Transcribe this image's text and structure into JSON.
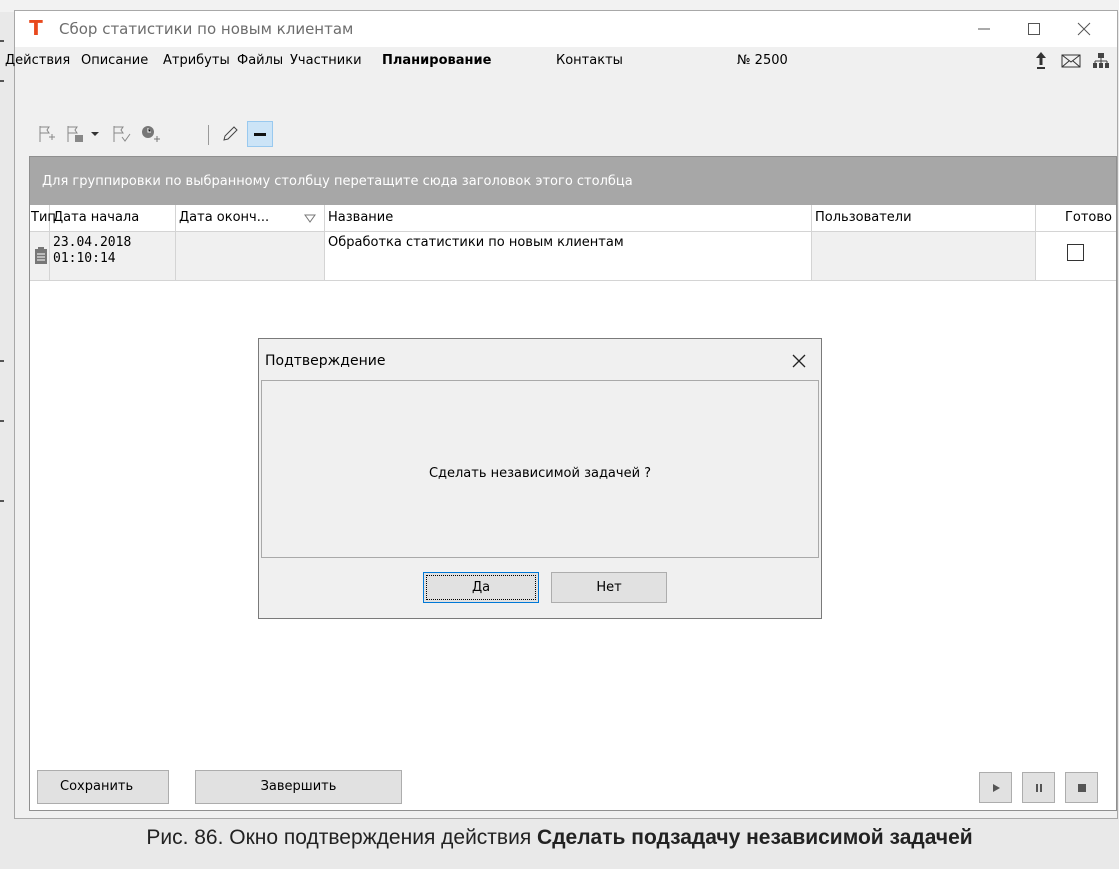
{
  "window": {
    "title": "Сбор статистики по новым клиентам"
  },
  "menu": {
    "items": [
      {
        "label": "Действия"
      },
      {
        "label": "Описание"
      },
      {
        "label": "Атрибуты"
      },
      {
        "label": "Файлы"
      },
      {
        "label": "Участники"
      },
      {
        "label": "Планирование",
        "active": true
      },
      {
        "label": "Контакты"
      }
    ],
    "number_label": "№",
    "number_value": "2500"
  },
  "grid": {
    "group_hint": "Для группировки по выбранному столбцу перетащите сюда заголовок этого столбца",
    "columns": [
      "Тип",
      "Дата начала",
      "Дата оконч...",
      "Название",
      "Пользователи",
      "Готово"
    ],
    "rows": [
      {
        "start_date": "23.04.2018",
        "start_time": "01:10:14",
        "end_date": "",
        "name": "Обработка статистики по новым клиентам",
        "users": "",
        "done": false
      }
    ]
  },
  "dialog": {
    "title": "Подтверждение",
    "message": "Сделать независимой задачей ?",
    "yes_label": "Да",
    "no_label": "Нет"
  },
  "footer": {
    "save_label": "Сохранить",
    "finish_label": "Завершить"
  },
  "caption": {
    "prefix": "Рис. 86. Окно подтверждения действия ",
    "bold": "Сделать подзадачу независимой задачей"
  },
  "colors": {
    "accent": "#e8491d",
    "group_bar": "#a7a7a7",
    "pressed": "#cce4f7"
  }
}
